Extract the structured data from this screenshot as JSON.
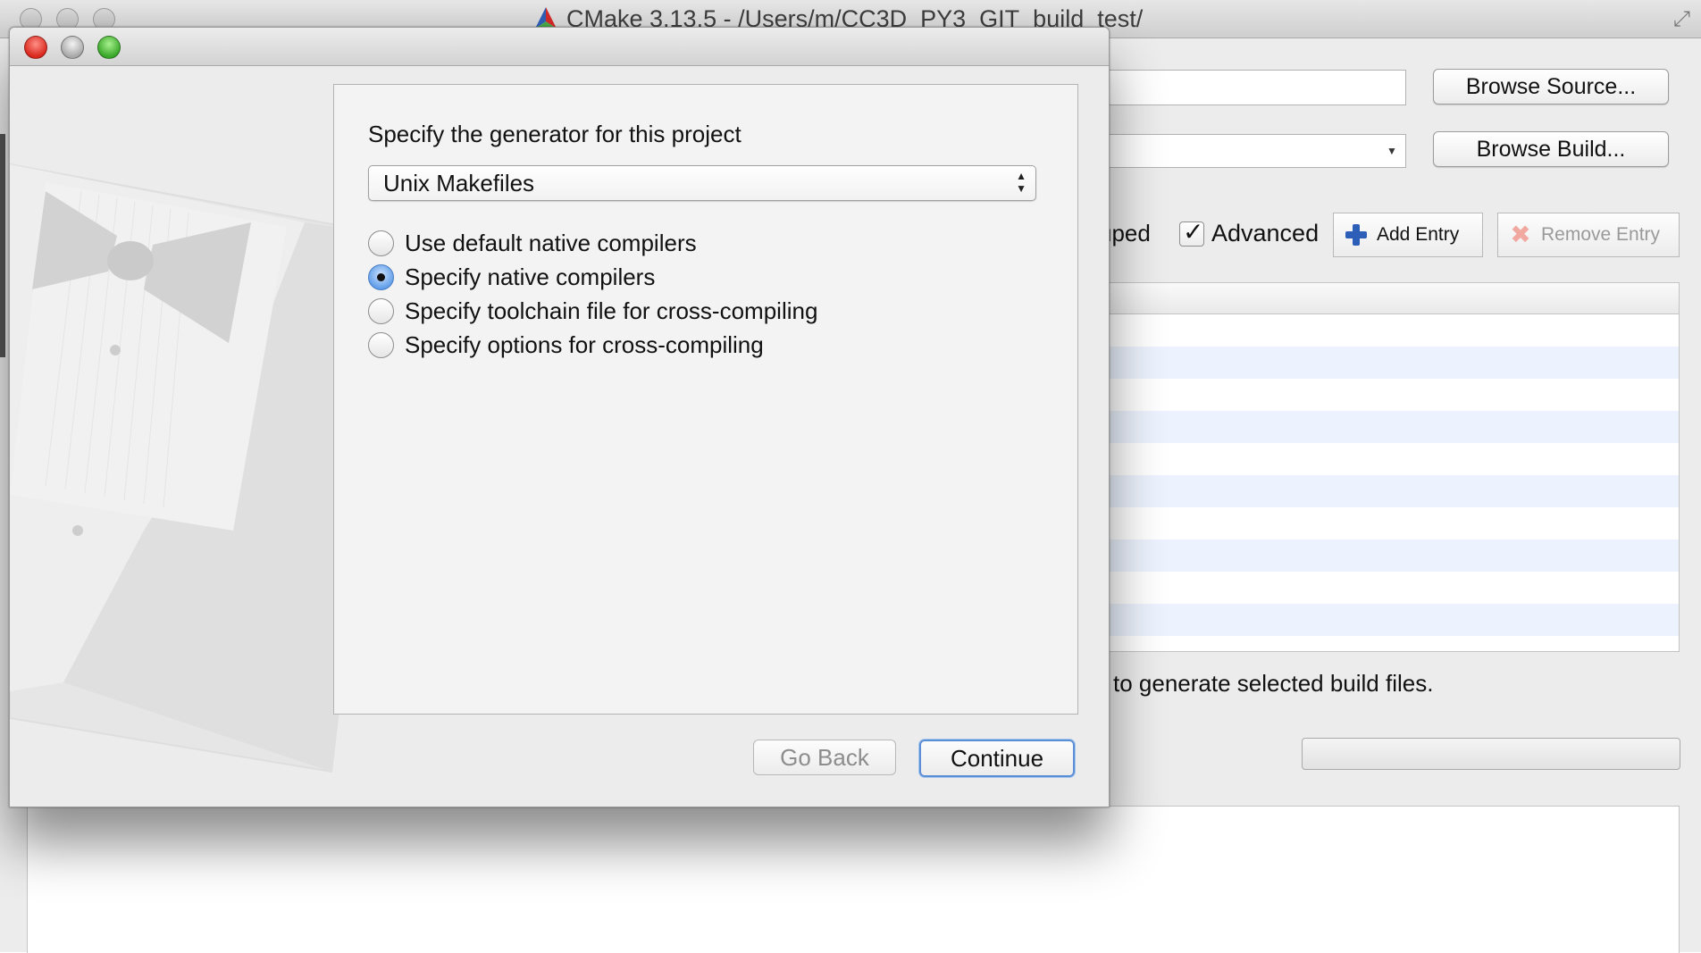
{
  "main_window": {
    "title": "CMake 3.13.5 - /Users/m/CC3D_PY3_GIT_build_test/",
    "browse_source_label": "Browse Source...",
    "browse_build_label": "Browse Build...",
    "grouped_label": "uped",
    "advanced_label": "Advanced",
    "advanced_checked": true,
    "add_entry_label": "Add Entry",
    "remove_entry_label": "Remove Entry",
    "status_text": "to generate selected build files."
  },
  "dialog": {
    "generator_prompt": "Specify the generator for this project",
    "generator_value": "Unix Makefiles",
    "options": [
      {
        "label": "Use default native compilers",
        "selected": false
      },
      {
        "label": "Specify native compilers",
        "selected": true
      },
      {
        "label": "Specify toolchain file for cross-compiling",
        "selected": false
      },
      {
        "label": "Specify options for cross-compiling",
        "selected": false
      }
    ],
    "go_back_label": "Go Back",
    "go_back_enabled": false,
    "continue_label": "Continue"
  },
  "colors": {
    "selection_blue": "#5b9ae8",
    "close_red": "#d9281d",
    "zoom_green": "#3aa829",
    "table_stripe": "#edf3fe"
  }
}
